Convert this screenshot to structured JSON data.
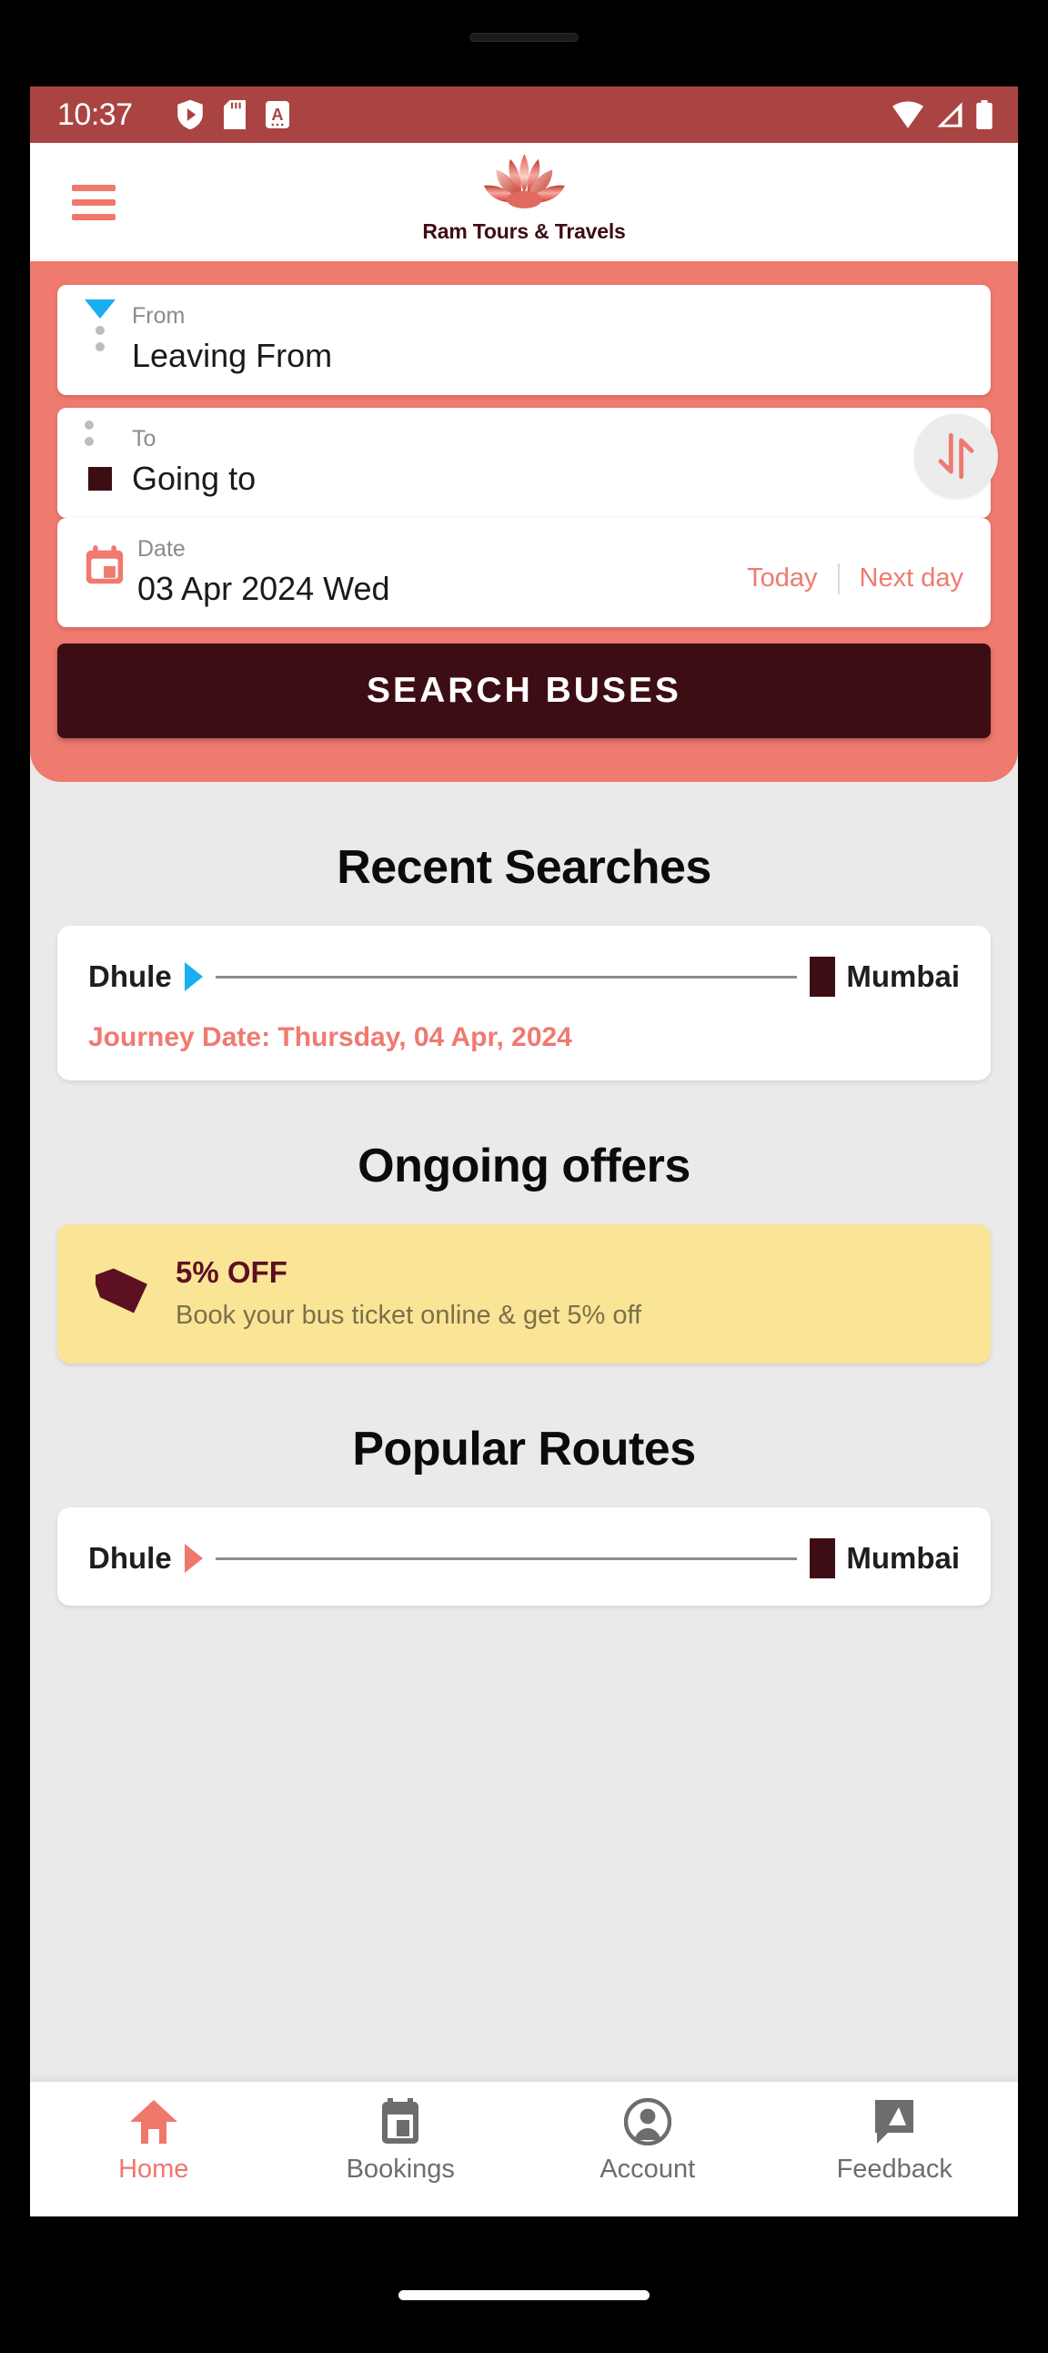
{
  "status_bar": {
    "time": "10:37",
    "left_icons": [
      "play-protect-shield-icon",
      "sd-card-icon",
      "letter-a-badge-icon"
    ],
    "right_icons": [
      "wifi-icon",
      "cellular-signal-icon",
      "battery-icon"
    ],
    "background_color": "#a94442"
  },
  "header": {
    "menu_icon": "hamburger-menu-icon",
    "logo_icon": "lotus-flower-logo",
    "brand_name": "Ram Tours & Travels",
    "brand_color": "#3d0d14"
  },
  "search_panel": {
    "background_color": "#ef7a70",
    "from": {
      "label": "From",
      "value": "Leaving From",
      "marker_icon": "blue-triangle-origin-marker"
    },
    "to": {
      "label": "To",
      "value": "Going to",
      "marker_icon": "dark-square-destination-marker"
    },
    "swap": {
      "icon": "swap-up-down-arrows-icon",
      "accent_color": "#ef7a70"
    },
    "date": {
      "label": "Date",
      "value": "03 Apr 2024 Wed",
      "icon": "calendar-icon",
      "today_label": "Today",
      "next_day_label": "Next day",
      "quick_link_color": "#ef7a70"
    },
    "search_button": {
      "label": "SEARCH BUSES",
      "background_color": "#3d0d14"
    }
  },
  "recent_searches": {
    "title": "Recent Searches",
    "items": [
      {
        "origin": "Dhule",
        "destination": "Mumbai",
        "journey_date": "Journey Date: Thursday, 04 Apr, 2024",
        "arrow_color": "#19aeef"
      }
    ]
  },
  "ongoing_offers": {
    "title": "Ongoing offers",
    "items": [
      {
        "icon": "price-tag-icon",
        "title": "5% OFF",
        "description": "Book your bus ticket online & get 5% off",
        "background_color": "#fae597"
      }
    ]
  },
  "popular_routes": {
    "title": "Popular Routes",
    "items": [
      {
        "origin": "Dhule",
        "destination": "Mumbai",
        "arrow_color": "#f0776c"
      }
    ]
  },
  "bottom_nav": {
    "items": [
      {
        "label": "Home",
        "icon": "home-icon",
        "active": true
      },
      {
        "label": "Bookings",
        "icon": "ticket-bookings-icon",
        "active": false
      },
      {
        "label": "Account",
        "icon": "account-person-icon",
        "active": false
      },
      {
        "label": "Feedback",
        "icon": "feedback-chat-icon",
        "active": false
      }
    ],
    "active_color": "#f0776c",
    "inactive_color": "#6d6d6d"
  }
}
